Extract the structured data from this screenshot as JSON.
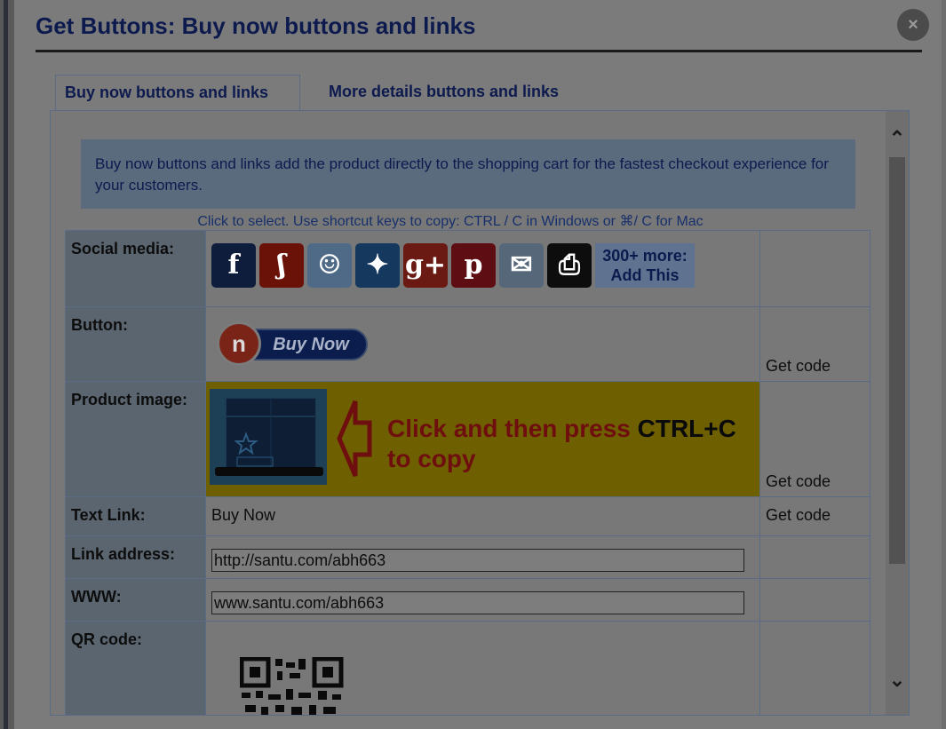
{
  "dialog": {
    "title": "Get Buttons: Buy now buttons and links",
    "close_label": "×"
  },
  "tabs": [
    {
      "label": "Buy now buttons and links",
      "active": true
    },
    {
      "label": "More details buttons and links",
      "active": false
    }
  ],
  "info": {
    "text": "Buy now buttons and links add the product directly to the shopping cart for the fastest checkout experience for your customers."
  },
  "hint": "Click to select. Use shortcut keys to copy: CTRL / C in Windows or ⌘/ C for Mac",
  "rows": {
    "social": {
      "label": "Social media:"
    },
    "button": {
      "label": "Button:",
      "button_text": "Buy Now",
      "badge": "n",
      "action": "Get code"
    },
    "product_image": {
      "label": "Product image:",
      "instruction_red": "Click and then press ",
      "instruction_key": "CTRL+C",
      "instruction_tail": "to copy",
      "action": "Get code"
    },
    "text_link": {
      "label": "Text Link:",
      "value": "Buy Now",
      "action": "Get code"
    },
    "link_address": {
      "label": "Link address:",
      "value": "http://santu.com/abh663"
    },
    "www": {
      "label": "WWW:",
      "value": "www.santu.com/abh663"
    },
    "qr": {
      "label": "QR code:"
    }
  },
  "social_icons": [
    {
      "name": "facebook-icon",
      "glyph": "f",
      "color": "#0f1d3d"
    },
    {
      "name": "stumbleupon-icon",
      "glyph": "ʃ",
      "color": "#6a1208"
    },
    {
      "name": "reddit-icon",
      "glyph": "☺",
      "color": "#4f6a86"
    },
    {
      "name": "twitter-icon",
      "glyph": "✦",
      "color": "#15395e"
    },
    {
      "name": "google-plus-icon",
      "glyph": "g+",
      "color": "#6a1a12"
    },
    {
      "name": "pinterest-icon",
      "glyph": "p",
      "color": "#5e0d12"
    },
    {
      "name": "email-icon",
      "glyph": "✉",
      "color": "#56677a"
    },
    {
      "name": "print-icon",
      "glyph": "⎙",
      "color": "#0d0d0d"
    }
  ],
  "addthis": {
    "line1": "300+ more:",
    "line2": "Add This"
  },
  "scrollbar": {
    "up": "⌃",
    "down": "⌄"
  }
}
